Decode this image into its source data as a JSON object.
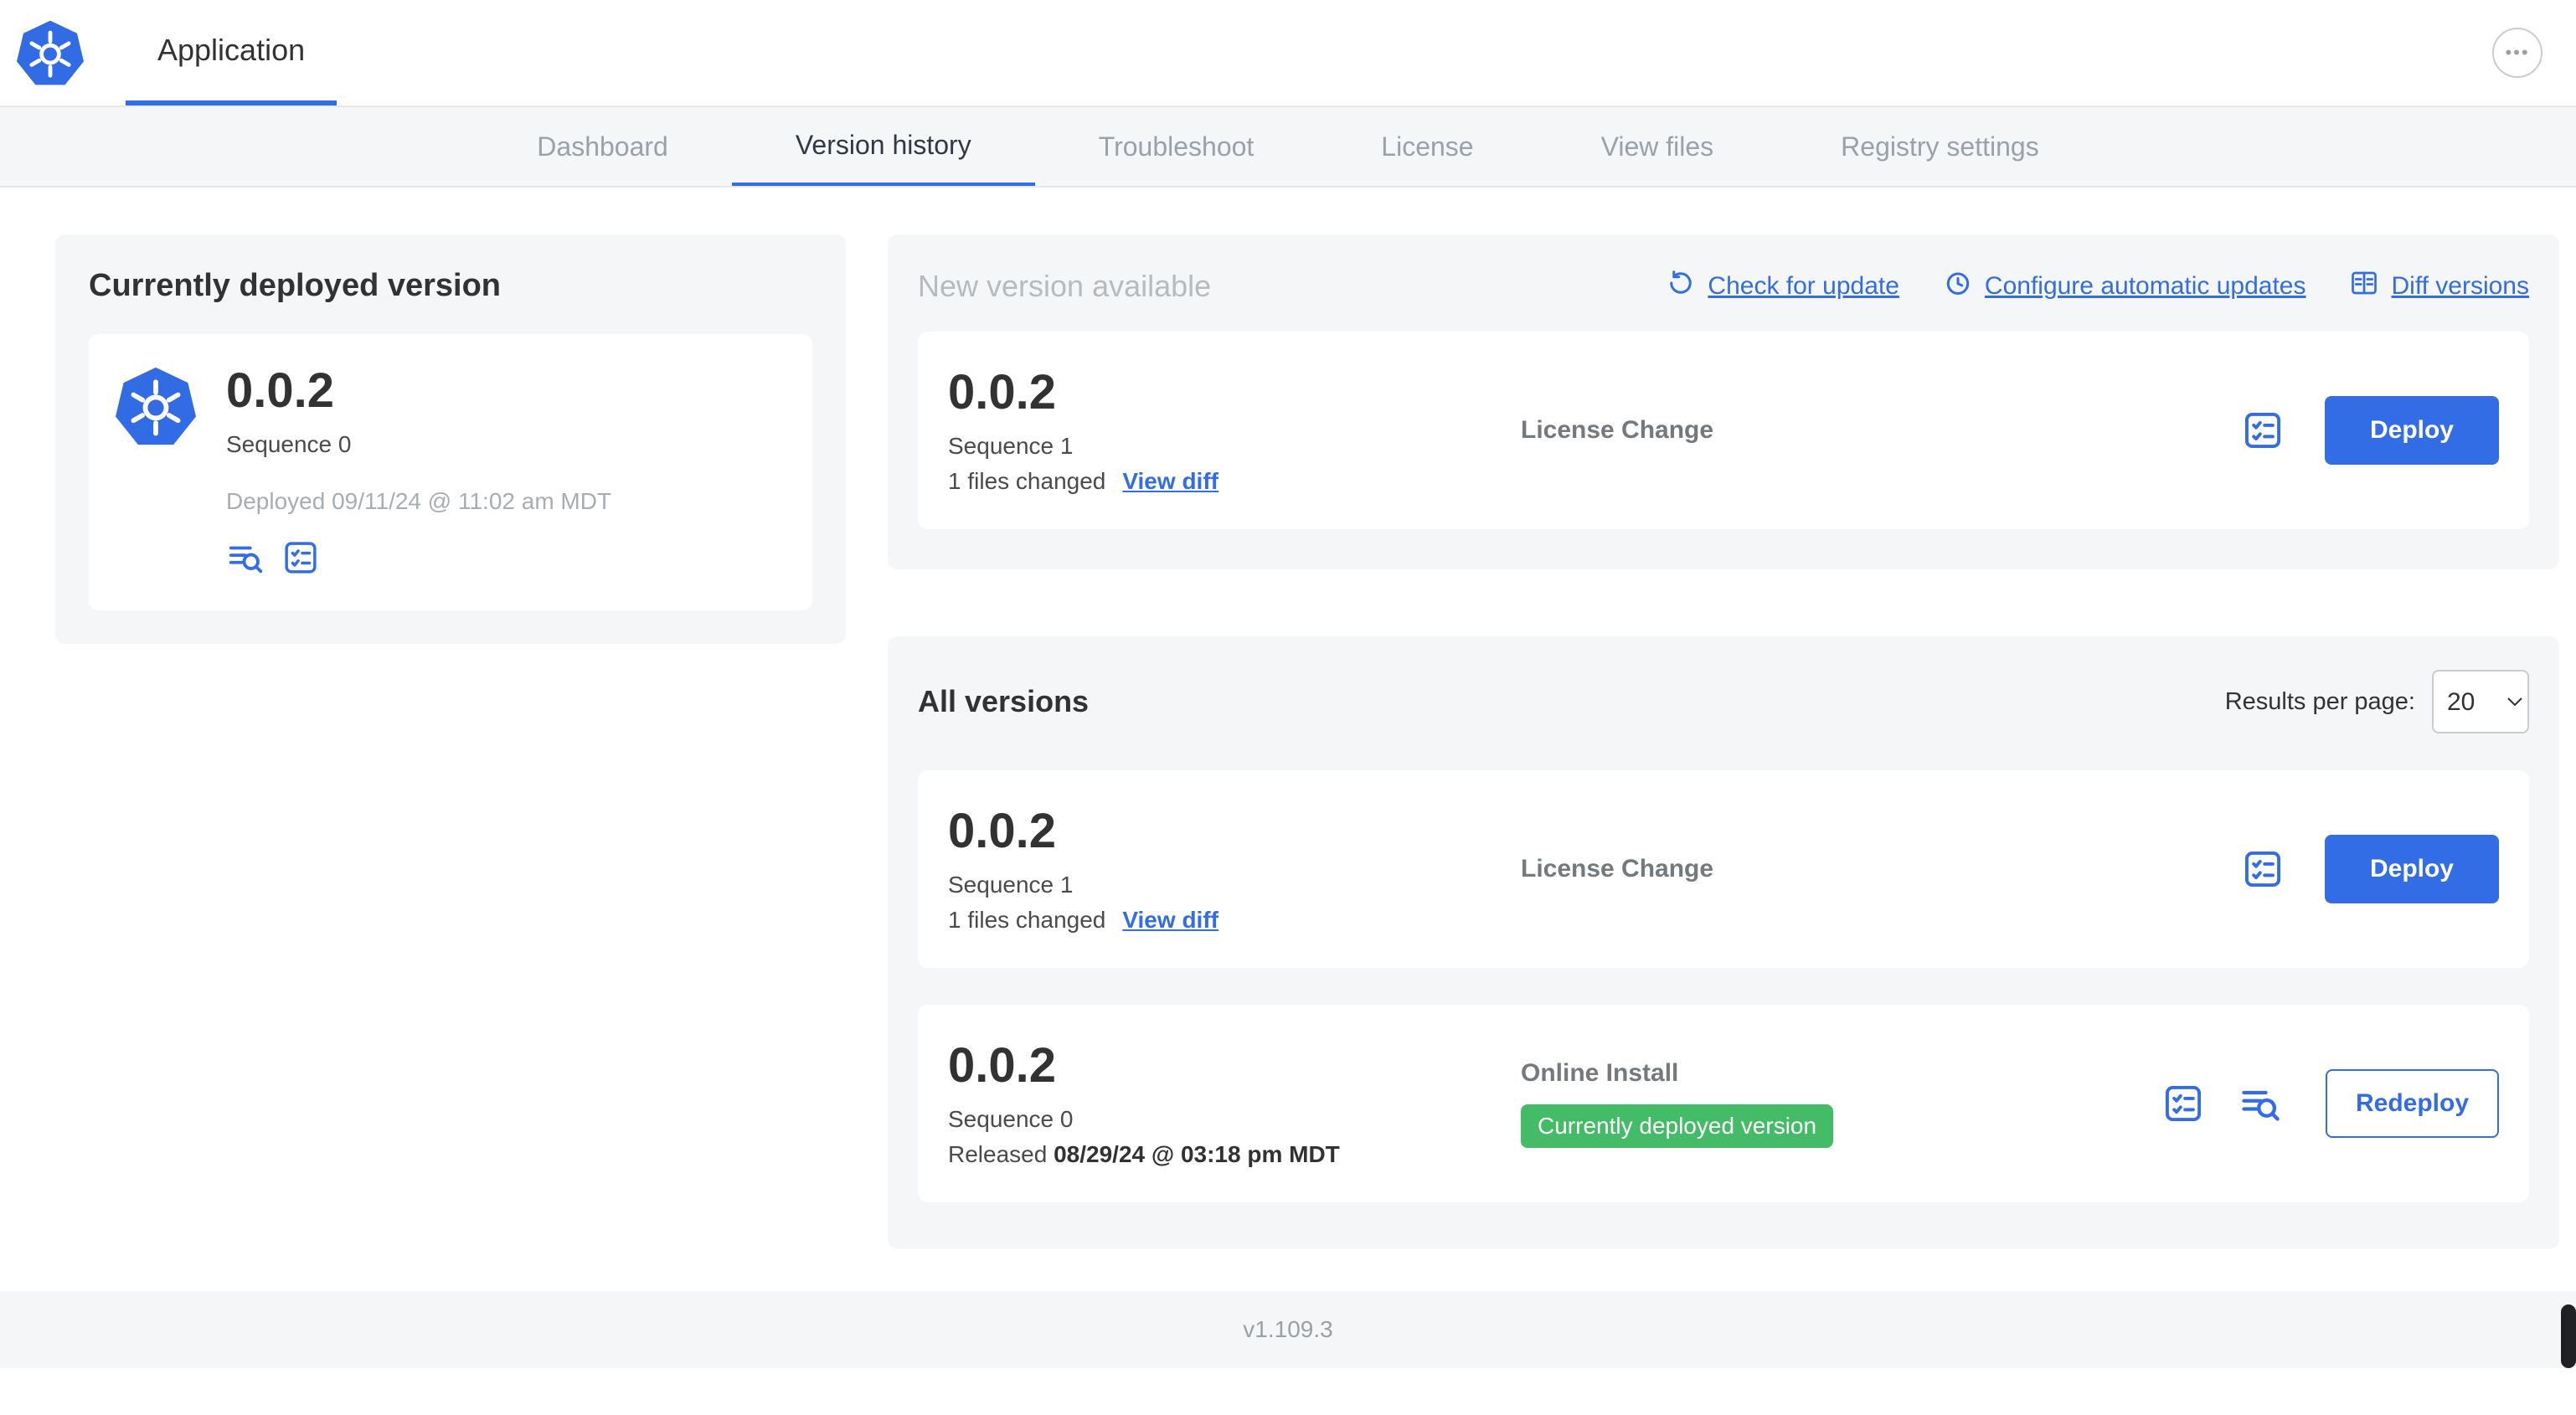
{
  "colors": {
    "accent": "#326de6",
    "badge_green": "#44bb66"
  },
  "header": {
    "app_tab": "Application",
    "more_label": "•••"
  },
  "nav": {
    "tabs": [
      "Dashboard",
      "Version history",
      "Troubleshoot",
      "License",
      "View files",
      "Registry settings"
    ],
    "active": "Version history"
  },
  "current": {
    "title": "Currently deployed version",
    "version": "0.0.2",
    "sequence": "Sequence 0",
    "deployed": "Deployed 09/11/24 @ 11:02 am MDT"
  },
  "new_version": {
    "title": "New version available",
    "check_link": "Check for update",
    "auto_link": "Configure automatic updates",
    "diff_link": "Diff versions",
    "row": {
      "version": "0.0.2",
      "sequence": "Sequence 1",
      "files": "1 files changed",
      "view_diff": "View diff",
      "source": "License Change",
      "action": "Deploy"
    }
  },
  "all_versions": {
    "title": "All versions",
    "per_page_label": "Results per page:",
    "per_page_value": "20",
    "rows": [
      {
        "version": "0.0.2",
        "sequence": "Sequence 1",
        "files": "1 files changed",
        "view_diff": "View diff",
        "source": "License Change",
        "action": "Deploy"
      },
      {
        "version": "0.0.2",
        "sequence": "Sequence 0",
        "released_label": "Released",
        "released_date": "08/29/24 @ 03:18 pm MDT",
        "source": "Online Install",
        "badge": "Currently deployed version",
        "action": "Redeploy"
      }
    ]
  },
  "footer": {
    "version": "v1.109.3"
  }
}
